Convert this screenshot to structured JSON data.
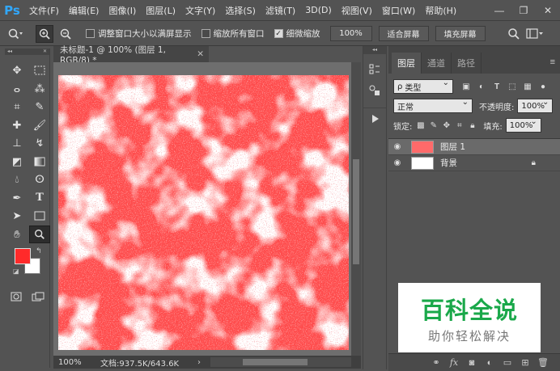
{
  "app": {
    "logo": "Ps"
  },
  "menu": [
    "文件(F)",
    "编辑(E)",
    "图像(I)",
    "图层(L)",
    "文字(Y)",
    "选择(S)",
    "滤镜(T)",
    "3D(D)",
    "视图(V)",
    "窗口(W)",
    "帮助(H)"
  ],
  "options": {
    "resize_windows": "调整窗口大小以满屏显示",
    "zoom_all": "缩放所有窗口",
    "scrubby_zoom": "细微缩放",
    "zoom_value": "100%",
    "fit_screen": "适合屏幕",
    "fill_screen": "填充屏幕"
  },
  "document": {
    "tab_title": "未标题-1 @ 100% (图层 1, RGB/8) *",
    "zoom": "100%",
    "doc_size": "文档:937.5K/643.6K",
    "noise_color": "#ff4b4b"
  },
  "colors": {
    "foreground": "#ff2a2a",
    "background": "#ffffff"
  },
  "layers_panel": {
    "tabs": [
      "图层",
      "通道",
      "路径"
    ],
    "filter_kind": "类型",
    "blend_mode": "正常",
    "opacity_label": "不透明度:",
    "opacity_value": "100%",
    "lock_label": "锁定:",
    "fill_label": "填充:",
    "fill_value": "100%",
    "layers": [
      {
        "name": "图层 1",
        "selected": true
      },
      {
        "name": "背景",
        "selected": false
      }
    ]
  },
  "watermark": {
    "title": "百科全说",
    "subtitle": "助你轻松解决"
  }
}
